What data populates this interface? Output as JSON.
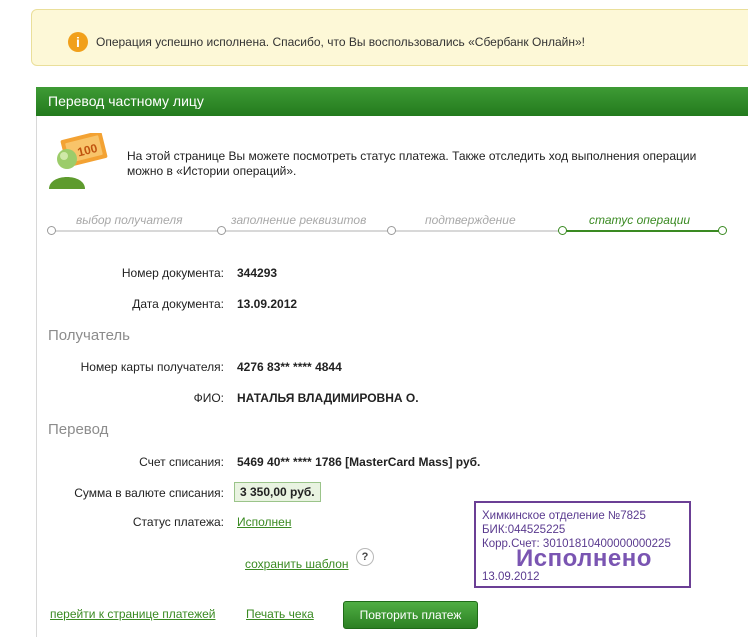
{
  "notice": {
    "icon": "info-icon",
    "icon_glyph": "i",
    "text": "Операция успешно исполнена. Спасибо, что Вы воспользовались «Сбербанк Онлайн»!"
  },
  "panel": {
    "title": "Перевод частному лицу",
    "intro": "На этой странице Вы можете посмотреть статус платежа. Также отследить ход выполнения операции можно в «Истории операций»."
  },
  "steps": [
    {
      "label": "выбор получателя",
      "active": false
    },
    {
      "label": "заполнение реквизитов",
      "active": false
    },
    {
      "label": "подтверждение",
      "active": false
    },
    {
      "label": "статус операции",
      "active": true
    }
  ],
  "document": {
    "number_label": "Номер документа:",
    "number": "344293",
    "date_label": "Дата документа:",
    "date": "13.09.2012"
  },
  "recipient": {
    "section_title": "Получатель",
    "card_label": "Номер карты получателя:",
    "card": "4276 83** **** 4844",
    "name_label": "ФИО:",
    "name": "НАТАЛЬЯ ВЛАДИМИРОВНА О."
  },
  "transfer": {
    "section_title": "Перевод",
    "account_label": "Счет списания:",
    "account": "5469 40** **** 1786  [MasterCard Mass]  руб.",
    "amount_label": "Сумма в валюте списания:",
    "amount": "3 350,00  руб.",
    "status_label": "Статус платежа:",
    "status": "Исполнен",
    "save_template": "сохранить шаблон",
    "help_glyph": "?"
  },
  "stamp": {
    "line1": "Химкинское отделение №7825",
    "line2": "БИК:044525225",
    "line3": "Корр.Счет: 30101810400000000225",
    "big": "Исполнено",
    "date": "13.09.2012"
  },
  "footer": {
    "payments_link": "перейти к странице платежей",
    "print_link": "Печать чека",
    "repeat_button": "Повторить платеж"
  },
  "colors": {
    "accent": "#3a8a22",
    "header": "#2e8a27",
    "notice_bg": "#fdf8d7",
    "stamp": "#6b3f95"
  }
}
